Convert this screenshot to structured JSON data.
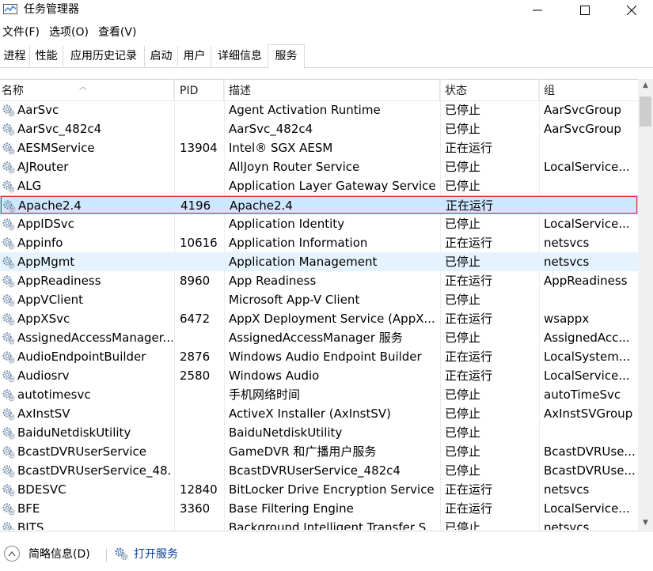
{
  "window": {
    "title": "任务管理器"
  },
  "menu": [
    "文件(F)",
    "选项(O)",
    "查看(V)"
  ],
  "tabs": [
    "进程",
    "性能",
    "应用历史记录",
    "启动",
    "用户",
    "详细信息",
    "服务"
  ],
  "active_tab": "服务",
  "columns": {
    "name": "名称",
    "pid": "PID",
    "desc": "描述",
    "status": "状态",
    "group": "组"
  },
  "rows": [
    {
      "name": "AarSvc",
      "pid": "",
      "desc": "Agent Activation Runtime",
      "status": "已停止",
      "group": "AarSvcGroup"
    },
    {
      "name": "AarSvc_482c4",
      "pid": "",
      "desc": "AarSvc_482c4",
      "status": "已停止",
      "group": "AarSvcGroup"
    },
    {
      "name": "AESMService",
      "pid": "13904",
      "desc": "Intel® SGX AESM",
      "status": "正在运行",
      "group": ""
    },
    {
      "name": "AJRouter",
      "pid": "",
      "desc": "AllJoyn Router Service",
      "status": "已停止",
      "group": "LocalService..."
    },
    {
      "name": "ALG",
      "pid": "",
      "desc": "Application Layer Gateway Service",
      "status": "已停止",
      "group": ""
    },
    {
      "name": "Apache2.4",
      "pid": "4196",
      "desc": "Apache2.4",
      "status": "正在运行",
      "group": ""
    },
    {
      "name": "AppIDSvc",
      "pid": "",
      "desc": "Application Identity",
      "status": "已停止",
      "group": "LocalService..."
    },
    {
      "name": "Appinfo",
      "pid": "10616",
      "desc": "Application Information",
      "status": "正在运行",
      "group": "netsvcs"
    },
    {
      "name": "AppMgmt",
      "pid": "",
      "desc": "Application Management",
      "status": "已停止",
      "group": "netsvcs"
    },
    {
      "name": "AppReadiness",
      "pid": "8960",
      "desc": "App Readiness",
      "status": "正在运行",
      "group": "AppReadiness"
    },
    {
      "name": "AppVClient",
      "pid": "",
      "desc": "Microsoft App-V Client",
      "status": "已停止",
      "group": ""
    },
    {
      "name": "AppXSvc",
      "pid": "6472",
      "desc": "AppX Deployment Service (AppX...",
      "status": "正在运行",
      "group": "wsappx"
    },
    {
      "name": "AssignedAccessManager...",
      "pid": "",
      "desc": "AssignedAccessManager 服务",
      "status": "已停止",
      "group": "AssignedAcc..."
    },
    {
      "name": "AudioEndpointBuilder",
      "pid": "2876",
      "desc": "Windows Audio Endpoint Builder",
      "status": "正在运行",
      "group": "LocalSystem..."
    },
    {
      "name": "Audiosrv",
      "pid": "2580",
      "desc": "Windows Audio",
      "status": "正在运行",
      "group": "LocalService..."
    },
    {
      "name": "autotimesvc",
      "pid": "",
      "desc": "手机网络时间",
      "status": "已停止",
      "group": "autoTimeSvc"
    },
    {
      "name": "AxInstSV",
      "pid": "",
      "desc": "ActiveX Installer (AxInstSV)",
      "status": "已停止",
      "group": "AxInstSVGroup"
    },
    {
      "name": "BaiduNetdiskUtility",
      "pid": "",
      "desc": "BaiduNetdiskUtility",
      "status": "已停止",
      "group": ""
    },
    {
      "name": "BcastDVRUserService",
      "pid": "",
      "desc": "GameDVR 和广播用户服务",
      "status": "已停止",
      "group": "BcastDVRUse..."
    },
    {
      "name": "BcastDVRUserService_48...",
      "pid": "",
      "desc": "BcastDVRUserService_482c4",
      "status": "已停止",
      "group": "BcastDVRUse..."
    },
    {
      "name": "BDESVC",
      "pid": "12840",
      "desc": "BitLocker Drive Encryption Service",
      "status": "正在运行",
      "group": "netsvcs"
    },
    {
      "name": "BFE",
      "pid": "3360",
      "desc": "Base Filtering Engine",
      "status": "正在运行",
      "group": "LocalService..."
    },
    {
      "name": "BITS",
      "pid": "",
      "desc": "Background Intelligent Transfer S...",
      "status": "已停止",
      "group": "netsvcs"
    }
  ],
  "selected_row": "Apache2.4",
  "hover_row": "AppMgmt",
  "footer": {
    "less_info": "简略信息(D)",
    "open_services": "打开服务"
  },
  "colors": {
    "selection_bg": "#cce8ff",
    "hover_bg": "#e5f3ff",
    "focus_outline": "#e03040",
    "link": "#0b3d91"
  },
  "icons": {
    "app": "task-manager-icon",
    "service": "gear-icon",
    "minimize": "minimize-icon",
    "maximize": "maximize-icon",
    "close": "close-icon"
  }
}
